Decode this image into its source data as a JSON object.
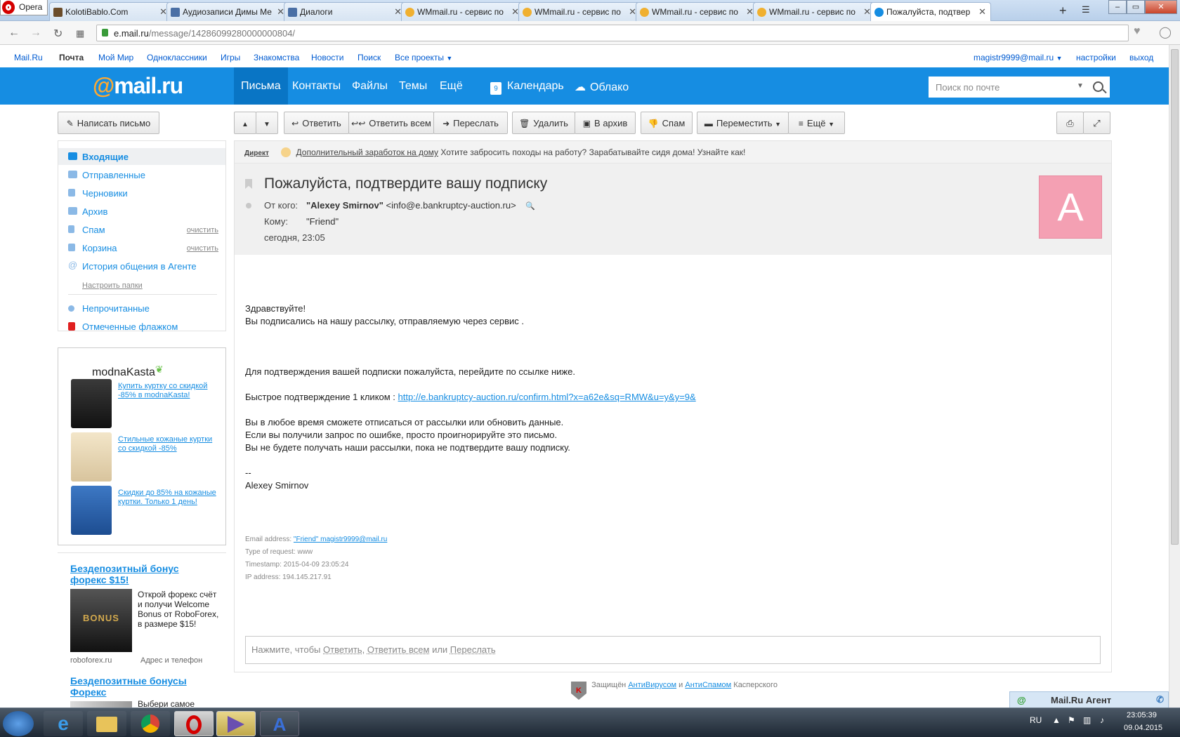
{
  "browser": {
    "opera_label": "Opera",
    "tabs": [
      {
        "title": "KolotiBablo.Com",
        "active": false
      },
      {
        "title": "Аудиозаписи Димы Ме",
        "active": false
      },
      {
        "title": "Диалоги",
        "active": false
      },
      {
        "title": "WMmail.ru - сервис по",
        "active": false
      },
      {
        "title": "WMmail.ru - сервис по",
        "active": false
      },
      {
        "title": "WMmail.ru - сервис по",
        "active": false
      },
      {
        "title": "WMmail.ru - сервис по",
        "active": false
      },
      {
        "title": "Пожалуйста, подтвер",
        "active": true
      }
    ],
    "url_domain": "e.mail.ru",
    "url_path": "/message/14286099280000000804/"
  },
  "portal": {
    "links": [
      "Mail.Ru",
      "Почта",
      "Мой Мир",
      "Одноклассники",
      "Игры",
      "Знакомства",
      "Новости",
      "Поиск",
      "Все проекты"
    ],
    "user": "magistr9999@mail.ru",
    "settings": "настройки",
    "logout": "выход"
  },
  "header": {
    "logo_at": "@",
    "logo_text": "mail.ru",
    "nav": [
      "Письма",
      "Контакты",
      "Файлы",
      "Темы",
      "Ещё"
    ],
    "calendar": "Календарь",
    "cloud": "Облако",
    "search_placeholder": "Поиск по почте"
  },
  "toolbar": {
    "compose": "Написать письмо",
    "reply": "Ответить",
    "reply_all": "Ответить всем",
    "forward": "Переслать",
    "delete": "Удалить",
    "archive": "В архив",
    "spam": "Спам",
    "move": "Переместить",
    "more": "Ещё"
  },
  "folders": {
    "items": [
      {
        "label": "Входящие"
      },
      {
        "label": "Отправленные"
      },
      {
        "label": "Черновики"
      },
      {
        "label": "Архив"
      },
      {
        "label": "Спам",
        "action": "очистить"
      },
      {
        "label": "Корзина",
        "action": "очистить"
      },
      {
        "label": "История общения в Агенте"
      }
    ],
    "setup": "Настроить папки",
    "unread": "Непрочитанные",
    "flagged": "Отмеченные флажком"
  },
  "ad1": {
    "brand": "modnaKasta",
    "items": [
      "Купить куртку со скидкой -85% в modnaKasta!",
      "Стильные кожаные куртки со скидкой -85%",
      "Скидки до 85% на кожаные куртки. Только 1 день!"
    ]
  },
  "ad2": {
    "title1": "Бездепозитный бонус форекс $15!",
    "text1": "Открой форекс счёт и получи Welcome Bonus от RoboForex, в размере $15!",
    "img_label": "BONUS",
    "domain": "roboforex.ru",
    "addr": "Адрес и телефон",
    "title2": "Бездепозитные бонусы Форекс",
    "text2": "Выбери самое"
  },
  "direct": {
    "label": "Директ",
    "link": "Дополнительный заработок на дому",
    "text": "Хотите забросить походы на работу? Зарабатывайте сидя дома! Узнайте как!"
  },
  "message": {
    "subject": "Пожалуйста, подтвердите вашу подписку",
    "from_label": "От кого:",
    "from_name": "\"Alexey Smirnov\"",
    "from_email": "<info@e.bankruptcy-auction.ru>",
    "to_label": "Кому:",
    "to_value": "\"Friend\"",
    "date": "сегодня, 23:05",
    "avatar_letter": "A",
    "body": {
      "greeting": "Здравствуйте!",
      "line1": "Вы подписались на нашу рассылку, отправляемую через сервис .",
      "line2": "Для подтверждения вашей подписки пожалуйста, перейдите по ссылке ниже.",
      "quick_label": "Быстрое подтверждение 1 кликом :",
      "link": "http://e.bankruptcy-auction.ru/confirm.html?x=a62e&sq=RMW&u=y&y=9&",
      "line3": "Вы в любое время сможете отписаться от рассылки или обновить данные.",
      "line4": "Если вы получили запрос по ошибке, просто проигнорируйте это письмо.",
      "line5": "Вы не будете получать наши рассылки, пока не подтвердите вашу подписку.",
      "sig_dash": "--",
      "signature": "Alexey Smirnov"
    },
    "meta": {
      "email_label": "Email address:",
      "email_value": "\"Friend\" magistr9999@mail.ru",
      "type": "Type of request: www",
      "timestamp": "Timestamp: 2015-04-09 23:05:24",
      "ip": "IP address: 194.145.217.91"
    },
    "reply_prompt": "Нажмите, чтобы",
    "reply_a": "Ответить",
    "reply_b": "Ответить всем",
    "reply_or": "или",
    "reply_c": "Переслать"
  },
  "kaspersky": {
    "text1": "Защищён",
    "link1": "АнтиВирусом",
    "and": "и",
    "link2": "АнтиСпамом",
    "text2": "Касперского"
  },
  "agent": {
    "label": "Mail.Ru Агент"
  },
  "taskbar": {
    "lang": "RU",
    "time": "23:05:39",
    "date": "09.04.2015"
  },
  "colors": {
    "brand_blue": "#168de2",
    "brand_orange": "#ffa930",
    "avatar_pink": "#f4a0b3"
  }
}
